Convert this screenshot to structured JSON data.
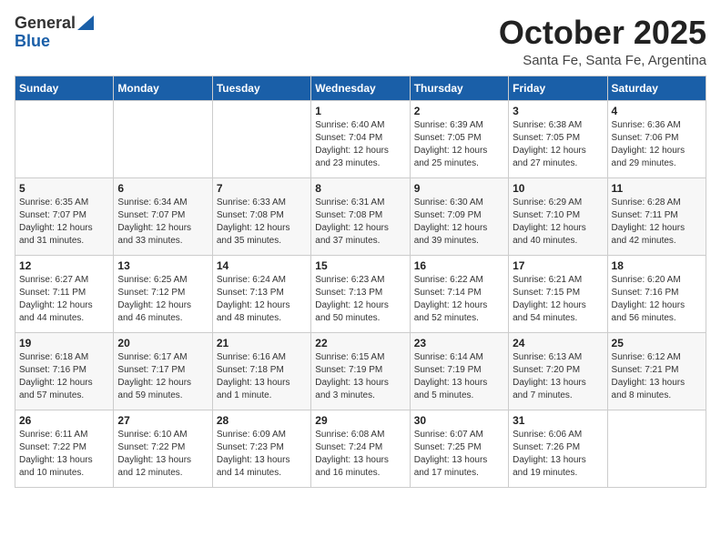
{
  "logo": {
    "general": "General",
    "blue": "Blue"
  },
  "title": "October 2025",
  "location": "Santa Fe, Santa Fe, Argentina",
  "days_of_week": [
    "Sunday",
    "Monday",
    "Tuesday",
    "Wednesday",
    "Thursday",
    "Friday",
    "Saturday"
  ],
  "weeks": [
    [
      {
        "day": "",
        "info": ""
      },
      {
        "day": "",
        "info": ""
      },
      {
        "day": "",
        "info": ""
      },
      {
        "day": "1",
        "info": "Sunrise: 6:40 AM\nSunset: 7:04 PM\nDaylight: 12 hours\nand 23 minutes."
      },
      {
        "day": "2",
        "info": "Sunrise: 6:39 AM\nSunset: 7:05 PM\nDaylight: 12 hours\nand 25 minutes."
      },
      {
        "day": "3",
        "info": "Sunrise: 6:38 AM\nSunset: 7:05 PM\nDaylight: 12 hours\nand 27 minutes."
      },
      {
        "day": "4",
        "info": "Sunrise: 6:36 AM\nSunset: 7:06 PM\nDaylight: 12 hours\nand 29 minutes."
      }
    ],
    [
      {
        "day": "5",
        "info": "Sunrise: 6:35 AM\nSunset: 7:07 PM\nDaylight: 12 hours\nand 31 minutes."
      },
      {
        "day": "6",
        "info": "Sunrise: 6:34 AM\nSunset: 7:07 PM\nDaylight: 12 hours\nand 33 minutes."
      },
      {
        "day": "7",
        "info": "Sunrise: 6:33 AM\nSunset: 7:08 PM\nDaylight: 12 hours\nand 35 minutes."
      },
      {
        "day": "8",
        "info": "Sunrise: 6:31 AM\nSunset: 7:08 PM\nDaylight: 12 hours\nand 37 minutes."
      },
      {
        "day": "9",
        "info": "Sunrise: 6:30 AM\nSunset: 7:09 PM\nDaylight: 12 hours\nand 39 minutes."
      },
      {
        "day": "10",
        "info": "Sunrise: 6:29 AM\nSunset: 7:10 PM\nDaylight: 12 hours\nand 40 minutes."
      },
      {
        "day": "11",
        "info": "Sunrise: 6:28 AM\nSunset: 7:11 PM\nDaylight: 12 hours\nand 42 minutes."
      }
    ],
    [
      {
        "day": "12",
        "info": "Sunrise: 6:27 AM\nSunset: 7:11 PM\nDaylight: 12 hours\nand 44 minutes."
      },
      {
        "day": "13",
        "info": "Sunrise: 6:25 AM\nSunset: 7:12 PM\nDaylight: 12 hours\nand 46 minutes."
      },
      {
        "day": "14",
        "info": "Sunrise: 6:24 AM\nSunset: 7:13 PM\nDaylight: 12 hours\nand 48 minutes."
      },
      {
        "day": "15",
        "info": "Sunrise: 6:23 AM\nSunset: 7:13 PM\nDaylight: 12 hours\nand 50 minutes."
      },
      {
        "day": "16",
        "info": "Sunrise: 6:22 AM\nSunset: 7:14 PM\nDaylight: 12 hours\nand 52 minutes."
      },
      {
        "day": "17",
        "info": "Sunrise: 6:21 AM\nSunset: 7:15 PM\nDaylight: 12 hours\nand 54 minutes."
      },
      {
        "day": "18",
        "info": "Sunrise: 6:20 AM\nSunset: 7:16 PM\nDaylight: 12 hours\nand 56 minutes."
      }
    ],
    [
      {
        "day": "19",
        "info": "Sunrise: 6:18 AM\nSunset: 7:16 PM\nDaylight: 12 hours\nand 57 minutes."
      },
      {
        "day": "20",
        "info": "Sunrise: 6:17 AM\nSunset: 7:17 PM\nDaylight: 12 hours\nand 59 minutes."
      },
      {
        "day": "21",
        "info": "Sunrise: 6:16 AM\nSunset: 7:18 PM\nDaylight: 13 hours\nand 1 minute."
      },
      {
        "day": "22",
        "info": "Sunrise: 6:15 AM\nSunset: 7:19 PM\nDaylight: 13 hours\nand 3 minutes."
      },
      {
        "day": "23",
        "info": "Sunrise: 6:14 AM\nSunset: 7:19 PM\nDaylight: 13 hours\nand 5 minutes."
      },
      {
        "day": "24",
        "info": "Sunrise: 6:13 AM\nSunset: 7:20 PM\nDaylight: 13 hours\nand 7 minutes."
      },
      {
        "day": "25",
        "info": "Sunrise: 6:12 AM\nSunset: 7:21 PM\nDaylight: 13 hours\nand 8 minutes."
      }
    ],
    [
      {
        "day": "26",
        "info": "Sunrise: 6:11 AM\nSunset: 7:22 PM\nDaylight: 13 hours\nand 10 minutes."
      },
      {
        "day": "27",
        "info": "Sunrise: 6:10 AM\nSunset: 7:22 PM\nDaylight: 13 hours\nand 12 minutes."
      },
      {
        "day": "28",
        "info": "Sunrise: 6:09 AM\nSunset: 7:23 PM\nDaylight: 13 hours\nand 14 minutes."
      },
      {
        "day": "29",
        "info": "Sunrise: 6:08 AM\nSunset: 7:24 PM\nDaylight: 13 hours\nand 16 minutes."
      },
      {
        "day": "30",
        "info": "Sunrise: 6:07 AM\nSunset: 7:25 PM\nDaylight: 13 hours\nand 17 minutes."
      },
      {
        "day": "31",
        "info": "Sunrise: 6:06 AM\nSunset: 7:26 PM\nDaylight: 13 hours\nand 19 minutes."
      },
      {
        "day": "",
        "info": ""
      }
    ]
  ]
}
